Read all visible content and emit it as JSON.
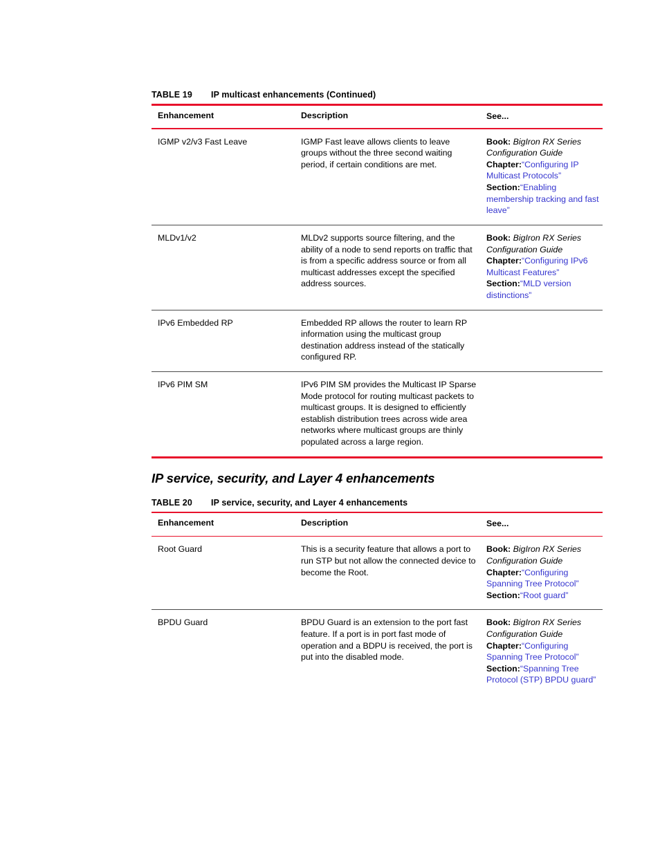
{
  "tables": [
    {
      "label": "TABLE 19",
      "caption": "IP multicast enhancements (Continued)",
      "columns": {
        "enhancement": "Enhancement",
        "description": "Description",
        "see": "See..."
      },
      "rows": [
        {
          "enhancement": "IGMP v2/v3 Fast Leave",
          "description": "IGMP Fast leave allows clients to leave groups without the three second waiting period, if certain conditions are met.",
          "see": {
            "book_label": "Book:",
            "book_title": "BigIron RX Series Configuration Guide",
            "chapter_label": "Chapter:",
            "chapter_link": "“Configuring IP Multicast Protocols”",
            "section_label": "Section:",
            "section_link": "“Enabling membership tracking and fast leave”"
          }
        },
        {
          "enhancement": "MLDv1/v2",
          "description": "MLDv2 supports source filtering, and the ability of a node to send reports on traffic that is from a specific address source or from all multicast addresses except the specified address sources.",
          "see": {
            "book_label": "Book:",
            "book_title": "BigIron RX Series Configuration Guide",
            "chapter_label": "Chapter:",
            "chapter_link": "“Configuring IPv6 Multicast Features”",
            "section_label": "Section:",
            "section_link": "“MLD version distinctions”"
          }
        },
        {
          "enhancement": "IPv6 Embedded RP",
          "description": "Embedded RP allows the router to learn RP information using the multicast group destination address instead of the statically configured RP.",
          "see": {
            "book_label": "",
            "book_title": "",
            "chapter_label": "",
            "chapter_link": "",
            "section_label": "",
            "section_link": ""
          }
        },
        {
          "enhancement": "IPv6 PIM SM",
          "description": "IPv6 PIM SM provides the Multicast IP Sparse Mode protocol for routing multicast packets to multicast groups. It is designed to efficiently establish distribution trees across wide area networks where multicast groups are thinly populated across a large region.",
          "see": {
            "book_label": "",
            "book_title": "",
            "chapter_label": "",
            "chapter_link": "",
            "section_label": "",
            "section_link": ""
          }
        }
      ]
    },
    {
      "label": "TABLE 20",
      "caption": "IP service, security, and Layer 4 enhancements",
      "columns": {
        "enhancement": "Enhancement",
        "description": "Description",
        "see": "See..."
      },
      "rows": [
        {
          "enhancement": "Root Guard",
          "description": "This is a security feature that allows a port to run STP but not allow the connected device to become the Root.",
          "see": {
            "book_label": "Book:",
            "book_title": "BigIron RX Series Configuration Guide",
            "chapter_label": "Chapter:",
            "chapter_link": "“Configuring Spanning Tree Protocol”",
            "section_label": "Section:",
            "section_link": "“Root guard”"
          }
        },
        {
          "enhancement": "BPDU Guard",
          "description": "BPDU Guard is an extension to the port fast feature. If a port is in port fast mode of operation and a BDPU is received, the port is put into the disabled mode.",
          "see": {
            "book_label": "Book:",
            "book_title": "BigIron RX Series Configuration Guide",
            "chapter_label": "Chapter:",
            "chapter_link": "“Configuring Spanning Tree Protocol”",
            "section_label": "Section:",
            "section_link": "“Spanning Tree Protocol (STP) BPDU guard”"
          }
        }
      ]
    }
  ],
  "section_heading": "IP service, security, and Layer 4 enhancements",
  "colors": {
    "rule_red": "#e8112b",
    "rule_dark": "#4a4a4a",
    "link_blue": "#3535cf",
    "text": "#000000"
  }
}
